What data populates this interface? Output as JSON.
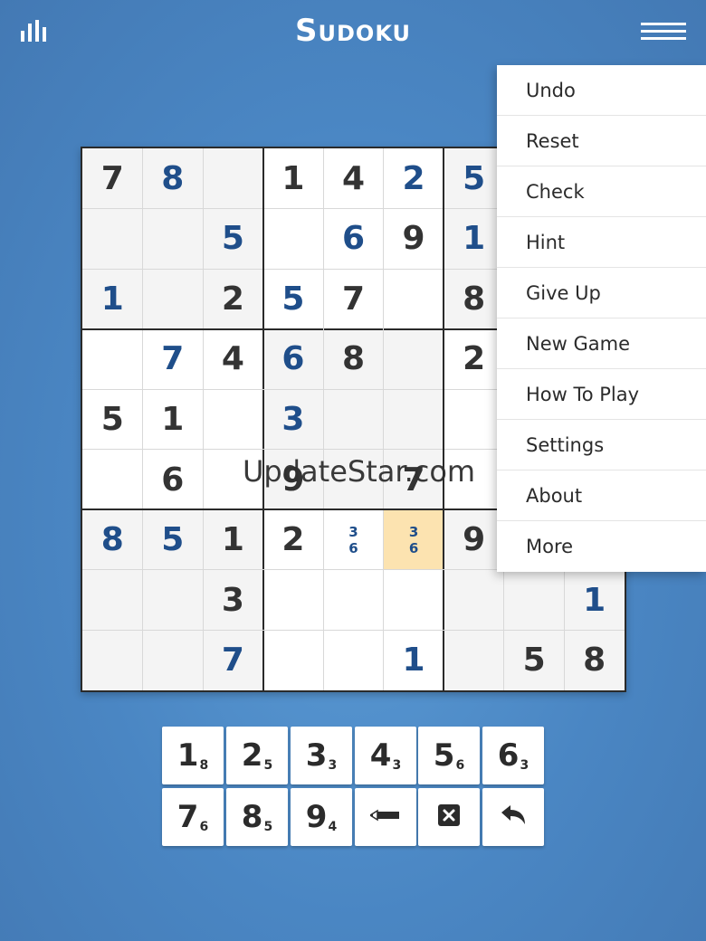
{
  "header": {
    "title": "Sudoku",
    "stats_icon": "bar-chart-icon",
    "menu_icon": "hamburger-menu-icon"
  },
  "colors": {
    "background": "#4a86c3",
    "user_digit": "#1f4e8a",
    "given_digit": "#333333",
    "selected_cell": "#fce3b0"
  },
  "board": {
    "rows": [
      [
        {
          "v": "7",
          "t": "given"
        },
        {
          "v": "8",
          "t": "user"
        },
        {
          "v": "",
          "t": "empty"
        },
        {
          "v": "1",
          "t": "given"
        },
        {
          "v": "4",
          "t": "given"
        },
        {
          "v": "2",
          "t": "user"
        },
        {
          "v": "5",
          "t": "user"
        },
        {
          "v": "",
          "t": "empty"
        },
        {
          "v": "",
          "t": "empty"
        }
      ],
      [
        {
          "v": "",
          "t": "empty"
        },
        {
          "v": "",
          "t": "empty"
        },
        {
          "v": "5",
          "t": "user"
        },
        {
          "v": "",
          "t": "empty"
        },
        {
          "v": "6",
          "t": "user"
        },
        {
          "v": "9",
          "t": "given"
        },
        {
          "v": "1",
          "t": "user"
        },
        {
          "v": "",
          "t": "empty"
        },
        {
          "v": "",
          "t": "empty"
        }
      ],
      [
        {
          "v": "1",
          "t": "user"
        },
        {
          "v": "",
          "t": "empty"
        },
        {
          "v": "2",
          "t": "given"
        },
        {
          "v": "5",
          "t": "user"
        },
        {
          "v": "7",
          "t": "given"
        },
        {
          "v": "",
          "t": "empty"
        },
        {
          "v": "8",
          "t": "given"
        },
        {
          "v": "",
          "t": "empty"
        },
        {
          "v": "",
          "t": "empty"
        }
      ],
      [
        {
          "v": "",
          "t": "empty"
        },
        {
          "v": "7",
          "t": "user"
        },
        {
          "v": "4",
          "t": "given"
        },
        {
          "v": "6",
          "t": "user"
        },
        {
          "v": "8",
          "t": "given"
        },
        {
          "v": "",
          "t": "empty"
        },
        {
          "v": "2",
          "t": "given"
        },
        {
          "v": "",
          "t": "empty"
        },
        {
          "v": "",
          "t": "empty"
        }
      ],
      [
        {
          "v": "5",
          "t": "given"
        },
        {
          "v": "1",
          "t": "given"
        },
        {
          "v": "",
          "t": "empty"
        },
        {
          "v": "3",
          "t": "user"
        },
        {
          "v": "",
          "t": "empty"
        },
        {
          "v": "",
          "t": "empty"
        },
        {
          "v": "",
          "t": "empty"
        },
        {
          "v": "",
          "t": "empty"
        },
        {
          "v": "",
          "t": "empty"
        }
      ],
      [
        {
          "v": "",
          "t": "empty"
        },
        {
          "v": "6",
          "t": "given"
        },
        {
          "v": "",
          "t": "empty"
        },
        {
          "v": "9",
          "t": "given"
        },
        {
          "v": "",
          "t": "empty"
        },
        {
          "v": "7",
          "t": "given"
        },
        {
          "v": "",
          "t": "empty"
        },
        {
          "v": "",
          "t": "empty"
        },
        {
          "v": "",
          "t": "empty"
        }
      ],
      [
        {
          "v": "8",
          "t": "user"
        },
        {
          "v": "5",
          "t": "user"
        },
        {
          "v": "1",
          "t": "given"
        },
        {
          "v": "2",
          "t": "given"
        },
        {
          "v": "",
          "t": "notes",
          "notes": [
            "3",
            "6"
          ]
        },
        {
          "v": "",
          "t": "notes",
          "notes": [
            "3",
            "6"
          ],
          "selected": true
        },
        {
          "v": "9",
          "t": "given"
        },
        {
          "v": "",
          "t": "empty"
        },
        {
          "v": "",
          "t": "empty"
        }
      ],
      [
        {
          "v": "",
          "t": "empty"
        },
        {
          "v": "",
          "t": "empty"
        },
        {
          "v": "3",
          "t": "given"
        },
        {
          "v": "",
          "t": "empty"
        },
        {
          "v": "",
          "t": "empty"
        },
        {
          "v": "",
          "t": "empty"
        },
        {
          "v": "",
          "t": "empty"
        },
        {
          "v": "",
          "t": "empty"
        },
        {
          "v": "1",
          "t": "user"
        }
      ],
      [
        {
          "v": "",
          "t": "empty"
        },
        {
          "v": "",
          "t": "empty"
        },
        {
          "v": "7",
          "t": "user"
        },
        {
          "v": "",
          "t": "empty"
        },
        {
          "v": "",
          "t": "empty"
        },
        {
          "v": "1",
          "t": "user"
        },
        {
          "v": "",
          "t": "empty"
        },
        {
          "v": "5",
          "t": "given"
        },
        {
          "v": "8",
          "t": "given"
        }
      ]
    ]
  },
  "menu": {
    "items": [
      "Undo",
      "Reset",
      "Check",
      "Hint",
      "Give Up",
      "New Game",
      "How To Play",
      "Settings",
      "About",
      "More"
    ]
  },
  "watermark": "UpdateStar.com",
  "keypad": {
    "keys": [
      {
        "digit": "1",
        "count": "8"
      },
      {
        "digit": "2",
        "count": "5"
      },
      {
        "digit": "3",
        "count": "3"
      },
      {
        "digit": "4",
        "count": "3"
      },
      {
        "digit": "5",
        "count": "6"
      },
      {
        "digit": "6",
        "count": "3"
      },
      {
        "digit": "7",
        "count": "6"
      },
      {
        "digit": "8",
        "count": "5"
      },
      {
        "digit": "9",
        "count": "4"
      }
    ],
    "tools": [
      "pencil-icon",
      "erase-icon",
      "undo-icon"
    ]
  }
}
